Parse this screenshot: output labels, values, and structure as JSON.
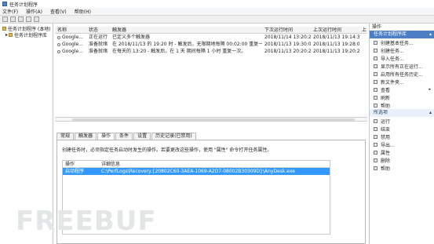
{
  "window": {
    "title": "任务计划程序"
  },
  "menu": [
    "文件(F)",
    "操作(A)",
    "查看(V)",
    "帮助(H)"
  ],
  "tree": {
    "root": "任务计划程序 (本地)",
    "child": "任务计划程序库"
  },
  "task_list": {
    "columns": [
      "名称",
      "状态",
      "触发器",
      "下次运行时间",
      "上次运行时间",
      "上"
    ],
    "rows": [
      {
        "name": "Google...",
        "status": "正在运行",
        "trigger": "已定义多个触发器",
        "next": "2018/11/14 13:20:22",
        "last": "2018/11/13 19:14:38"
      },
      {
        "name": "Google...",
        "status": "准备就绪",
        "trigger": "在 2018/11/13 的 19:20 时 - 触发后，无限期地每隔 00:02:00 重复一次。",
        "next": "2018/11/13 19:30:00",
        "last": "2018/11/13 19:28:00"
      },
      {
        "name": "Google...",
        "status": "准备就绪",
        "trigger": "在每天的 13:20 - 触发后，在 1 天 期间每隔 1 小时 重复一次。",
        "next": "2018/11/13 20:20:22",
        "last": "2018/11/13 19:20:22"
      }
    ]
  },
  "tabs": [
    "常规",
    "触发器",
    "操作",
    "条件",
    "设置",
    "历史记录(已禁用)"
  ],
  "actions_tab": {
    "description": "创建任务时，必须指定任务启动时发生的操作。若要更改这些操作，使用 \"属性\" 命令打开任务属性。",
    "columns": [
      "操作",
      "详细信息"
    ],
    "row": {
      "action": "启动程序",
      "detail": "C:\\PerfLogs\\Recovery.{20802C60-3AEA-1069-A2D7-08002B30309D}\\AnyDesk.exe"
    }
  },
  "actions_panel": {
    "title": "操作",
    "library_header": "任务计划程序库",
    "library_items": [
      {
        "label": "创建基本任务...",
        "icon": "create-basic-task-icon"
      },
      {
        "label": "创建任务...",
        "icon": "create-task-icon"
      },
      {
        "label": "导入任务...",
        "icon": "import-task-icon"
      },
      {
        "label": "显示所有正在运行...",
        "icon": "running-tasks-icon"
      },
      {
        "label": "启用所有任务历史...",
        "icon": "history-icon"
      },
      {
        "label": "新文件夹...",
        "icon": "new-folder-icon"
      },
      {
        "label": "查看",
        "icon": "view-icon",
        "submenu": "▸"
      },
      {
        "label": "刷新",
        "icon": "refresh-icon"
      },
      {
        "label": "帮助",
        "icon": "help-icon"
      }
    ],
    "selected_header": "所选项",
    "selected_items": [
      {
        "label": "运行",
        "icon": "run-icon"
      },
      {
        "label": "结束",
        "icon": "end-icon"
      },
      {
        "label": "禁用",
        "icon": "disable-icon"
      },
      {
        "label": "导出...",
        "icon": "export-icon"
      },
      {
        "label": "属性",
        "icon": "properties-icon"
      },
      {
        "label": "删除",
        "icon": "delete-icon"
      },
      {
        "label": "帮助",
        "icon": "help-icon"
      }
    ]
  },
  "watermark": "FREEBUF",
  "colors": {
    "selection": "#3399ff",
    "section_header": "#4a7fc6"
  }
}
